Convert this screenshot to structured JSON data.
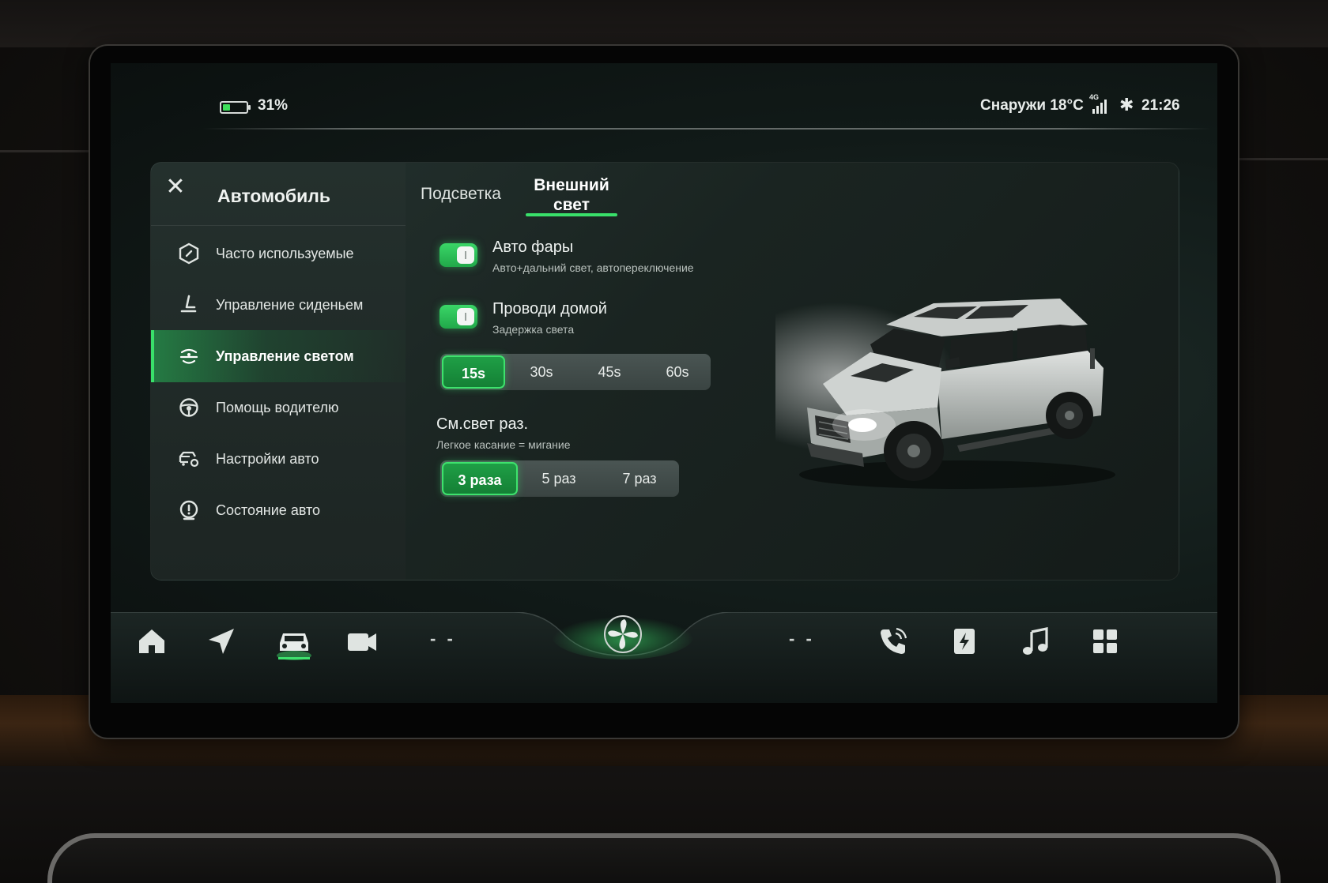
{
  "status": {
    "battery_percent": "31%",
    "battery_level": 0.31,
    "outside_temp": "Снаружи 18°C",
    "network": "4G",
    "time": "21:26"
  },
  "sidebar": {
    "title": "Автомобиль",
    "items": [
      {
        "label": "Часто используемые",
        "icon": "hexagon-icon",
        "active": false
      },
      {
        "label": "Управление сиденьем",
        "icon": "seat-icon",
        "active": false
      },
      {
        "label": "Управление светом",
        "icon": "headlight-icon",
        "active": true
      },
      {
        "label": "Помощь водителю",
        "icon": "steering-wheel-icon",
        "active": false
      },
      {
        "label": "Настройки авто",
        "icon": "car-settings-icon",
        "active": false
      },
      {
        "label": "Состояние авто",
        "icon": "car-status-icon",
        "active": false
      }
    ]
  },
  "tabs": [
    {
      "label": "Подсветка",
      "active": false
    },
    {
      "label_line1": "Внешний",
      "label_line2": "свет",
      "active": true
    }
  ],
  "settings": {
    "auto_headlights": {
      "title": "Авто фары",
      "subtitle": "Авто+дальний свет, автопереключение",
      "enabled": true
    },
    "follow_me_home": {
      "title": "Проводи домой",
      "subtitle": "Задержка света",
      "enabled": true,
      "options": [
        "15s",
        "30s",
        "45s",
        "60s"
      ],
      "selected": "15s"
    },
    "lane_change_flash": {
      "title": "См.свет раз.",
      "subtitle": "Легкое касание = мигание",
      "options": [
        "3 раза",
        "5 раз",
        "7 раз"
      ],
      "selected": "3 раза"
    }
  },
  "dock": {
    "items": [
      "home-icon",
      "navigation-icon",
      "vehicle-icon",
      "camera-icon",
      "left-climate-temp",
      "fan-icon",
      "right-climate-temp",
      "phone-icon",
      "charging-icon",
      "music-icon",
      "apps-grid-icon"
    ],
    "left_temp": "- -",
    "right_temp": "- -",
    "active": "vehicle-icon"
  },
  "colors": {
    "accent": "#39e06a",
    "selected_fill": "#1a9140",
    "panel": "#1d2623"
  }
}
